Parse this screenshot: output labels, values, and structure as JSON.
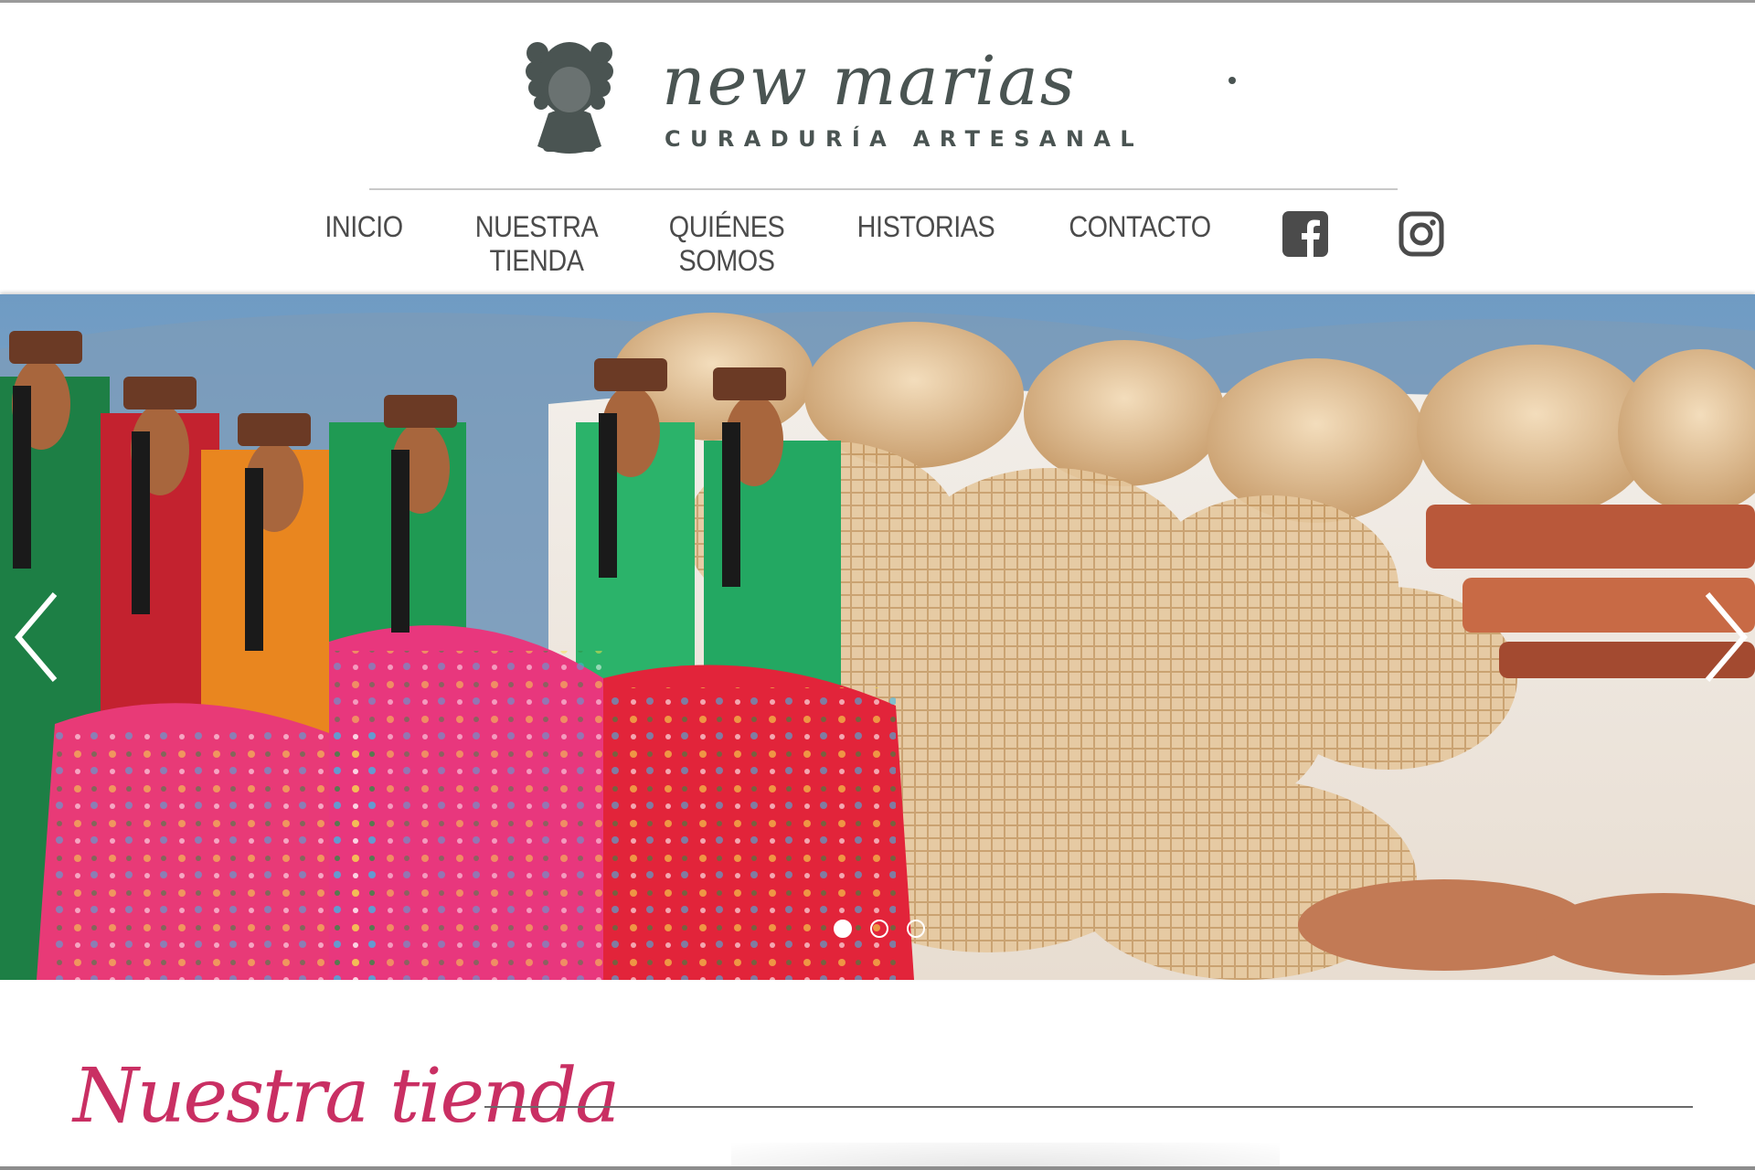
{
  "brand": {
    "name": "new marias",
    "tagline": "CURADURÍA ARTESANAL",
    "logo_color": "#4a5452"
  },
  "nav": {
    "items": [
      {
        "line1": "INICIO",
        "line2": ""
      },
      {
        "line1": "NUESTRA",
        "line2": "TIENDA"
      },
      {
        "line1": "QUIÉNES",
        "line2": "SOMOS"
      },
      {
        "line1": "HISTORIAS",
        "line2": ""
      },
      {
        "line1": "CONTACTO",
        "line2": ""
      }
    ],
    "social": [
      "facebook-icon",
      "instagram-icon"
    ]
  },
  "carousel": {
    "slide_count": 3,
    "active_slide": 1,
    "controls": [
      "chevron-left-icon",
      "chevron-right-icon"
    ]
  },
  "section": {
    "title": "Nuestra tienda",
    "accent_color": "#c92f63"
  }
}
